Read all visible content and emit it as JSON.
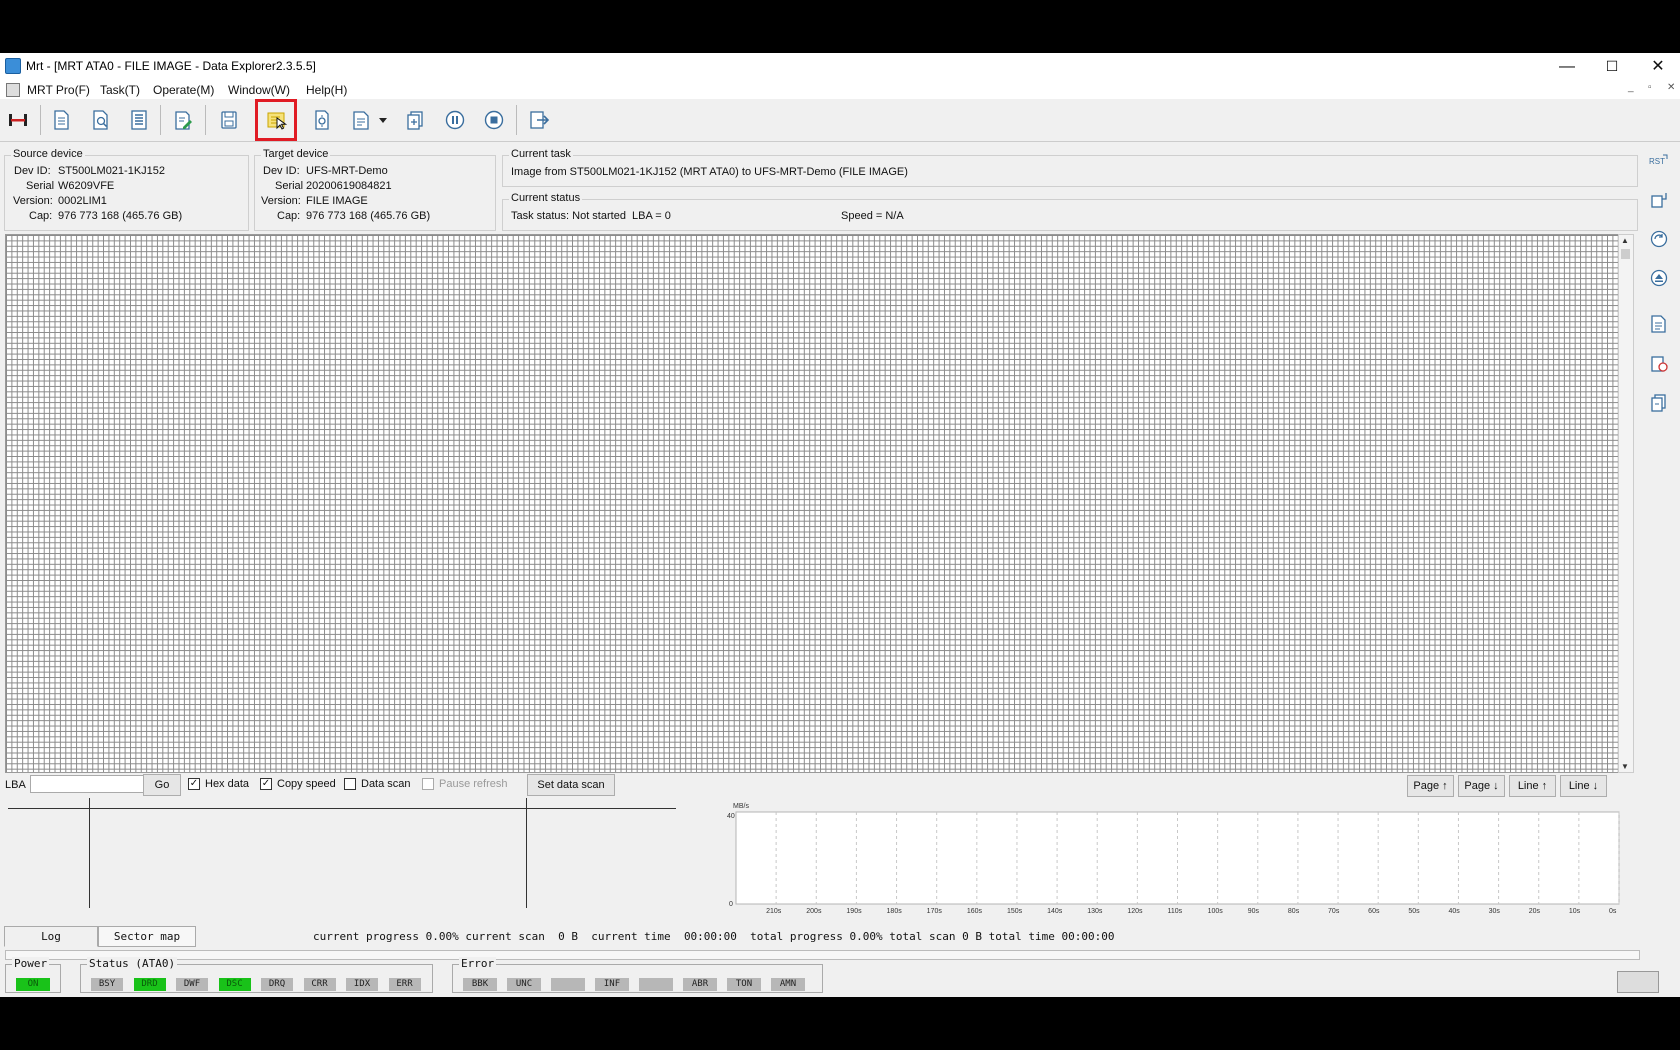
{
  "window": {
    "title": "Mrt - [MRT ATA0 - FILE IMAGE - Data Explorer2.3.5.5]",
    "controls": {
      "minimize": "—",
      "maximize": "☐",
      "close": "✕"
    }
  },
  "menu": {
    "items": [
      "MRT Pro(F)",
      "Task(T)",
      "Operate(M)",
      "Window(W)",
      "Help(H)"
    ],
    "mdi_controls": [
      "_",
      "▫",
      "✕"
    ]
  },
  "toolbar": {
    "buttons": [
      "connect-icon",
      "document-icon",
      "document-search-icon",
      "document-list-icon",
      "edit-document-icon",
      "save-icon",
      "image-task-icon",
      "scan-icon",
      "report-icon",
      "copy-icon",
      "pause-icon",
      "stop-icon",
      "exit-icon"
    ],
    "highlighted": "image-task-icon"
  },
  "source_device": {
    "title": "Source device",
    "dev_id_label": "Dev ID:",
    "dev_id": "ST500LM021-1KJ152",
    "serial_label": "Serial",
    "serial": "W6209VFE",
    "version_label": "Version:",
    "version": "0002LIM1",
    "cap_label": "Cap:",
    "cap": "976 773 168 (465.76 GB)"
  },
  "target_device": {
    "title": "Target device",
    "dev_id_label": "Dev ID:",
    "dev_id": "UFS-MRT-Demo",
    "serial_label": "Serial",
    "serial": "20200619084821",
    "version_label": "Version:",
    "version": "FILE IMAGE",
    "cap_label": "Cap:",
    "cap": "976 773 168 (465.76 GB)"
  },
  "current_task": {
    "title": "Current task",
    "text": "Image from ST500LM021-1KJ152 (MRT ATA0) to UFS-MRT-Demo (FILE IMAGE)"
  },
  "current_status": {
    "title": "Current status",
    "task_status": "Task status: Not started  LBA = 0",
    "speed": "Speed = N/A"
  },
  "side_tools": {
    "rst_label": "RST"
  },
  "controls": {
    "lba_label": "LBA",
    "lba_value": "",
    "go": "Go",
    "hex_data": {
      "label": "Hex data",
      "checked": true
    },
    "copy_speed": {
      "label": "Copy speed",
      "checked": true
    },
    "data_scan": {
      "label": "Data scan",
      "checked": false
    },
    "pause_refresh": {
      "label": "Pause refresh",
      "checked": false,
      "disabled": true
    },
    "set_data_scan": "Set data scan",
    "page_up": "Page ↑",
    "page_down": "Page ↓",
    "line_up": "Line ↑",
    "line_down": "Line ↓"
  },
  "chart_data": {
    "type": "line",
    "ylabel": "MB/s",
    "ylim": [
      0,
      40
    ],
    "y_ticks": [
      "40",
      "0"
    ],
    "x_ticks": [
      "210s",
      "200s",
      "190s",
      "180s",
      "170s",
      "160s",
      "150s",
      "140s",
      "130s",
      "120s",
      "110s",
      "100s",
      "90s",
      "80s",
      "70s",
      "60s",
      "50s",
      "40s",
      "30s",
      "20s",
      "10s",
      "0s"
    ],
    "series": [],
    "grid": true
  },
  "tabs": {
    "log": "Log",
    "sector_map": "Sector map"
  },
  "progress": {
    "current_progress_label": "current progress",
    "current_progress": "0.00%",
    "current_scan_label": "current scan",
    "current_scan": "0 B",
    "current_time_label": "current time",
    "current_time": "00:00:00",
    "total_progress_label": "total progress",
    "total_progress": "0.00%",
    "total_scan_label": "total scan",
    "total_scan": "0 B",
    "total_time_label": "total time",
    "total_time": "00:00:00"
  },
  "status_bar": {
    "power_title": "Power",
    "power": {
      "label": "ON",
      "on": true
    },
    "status_title": "Status (ATA0)",
    "status": [
      {
        "label": "BSY",
        "on": false
      },
      {
        "label": "DRD",
        "on": true
      },
      {
        "label": "DWF",
        "on": false
      },
      {
        "label": "DSC",
        "on": true
      },
      {
        "label": "DRQ",
        "on": false
      },
      {
        "label": "CRR",
        "on": false
      },
      {
        "label": "IDX",
        "on": false
      },
      {
        "label": "ERR",
        "on": false
      }
    ],
    "error_title": "Error",
    "errors": [
      {
        "label": "BBK",
        "on": false
      },
      {
        "label": "UNC",
        "on": false
      },
      {
        "label": "",
        "on": false
      },
      {
        "label": "INF",
        "on": false
      },
      {
        "label": "",
        "on": false
      },
      {
        "label": "ABR",
        "on": false
      },
      {
        "label": "TON",
        "on": false
      },
      {
        "label": "AMN",
        "on": false
      }
    ]
  },
  "colors": {
    "led_on": "#19c219",
    "led_off": "#b7b7b7",
    "highlight": "#e01b24"
  }
}
